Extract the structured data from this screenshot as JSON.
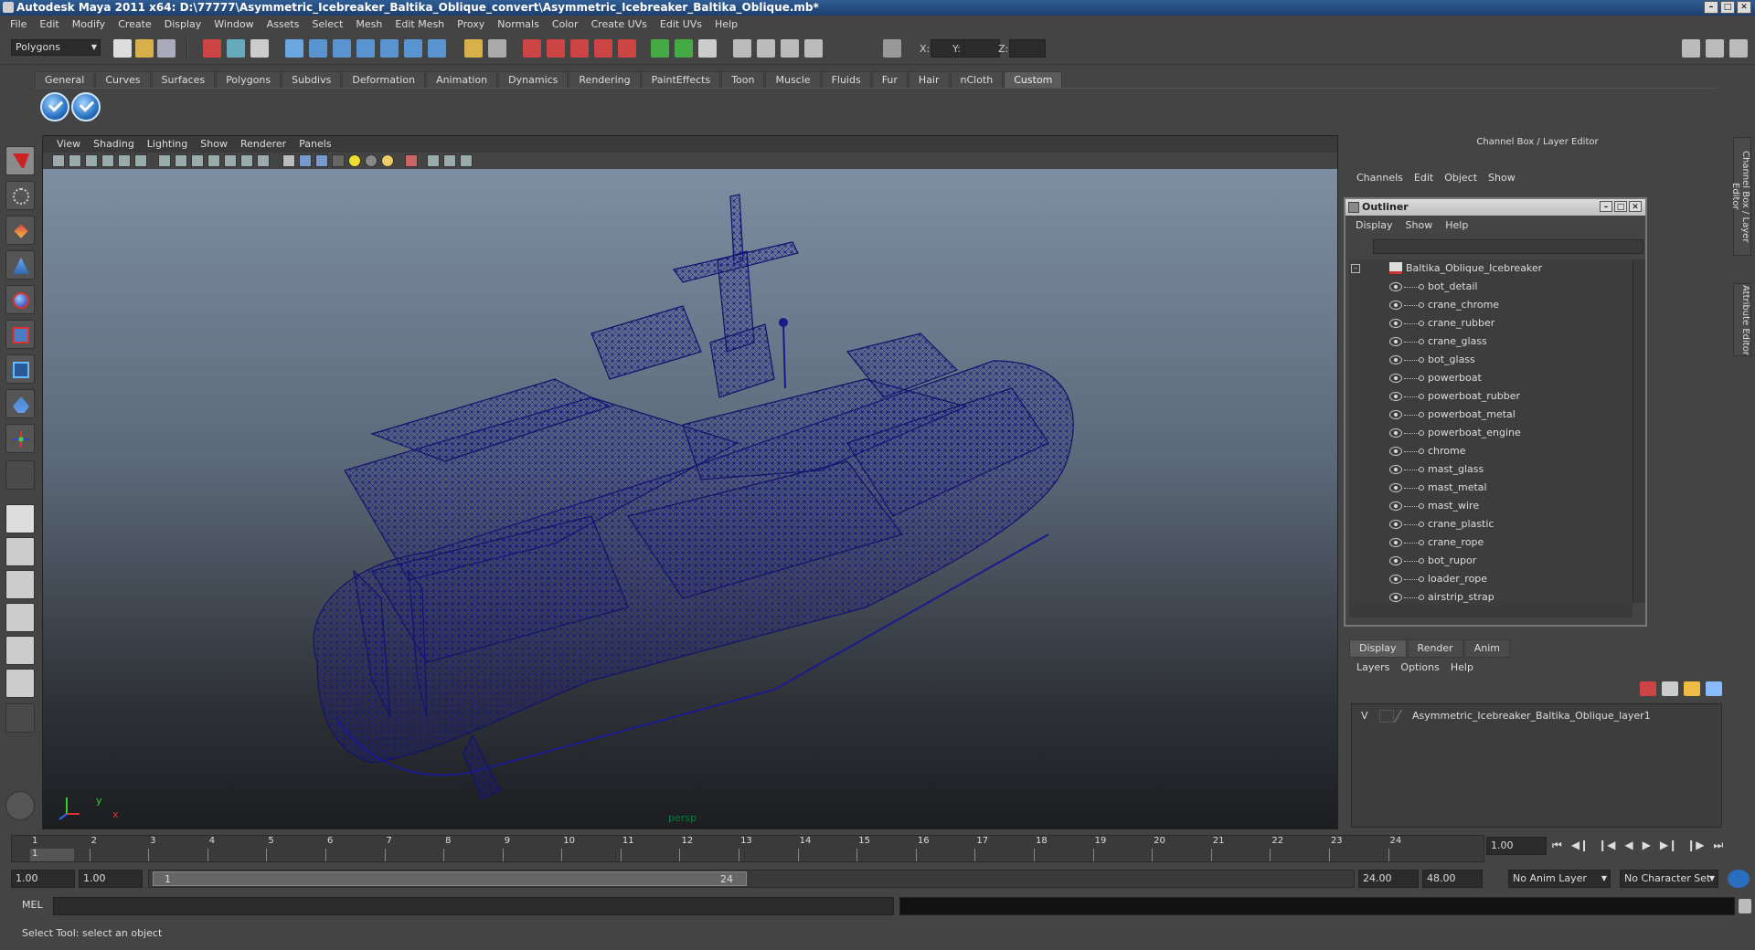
{
  "window": {
    "title": "Autodesk Maya 2011 x64: D:\\77777\\Asymmetric_Icebreaker_Baltika_Oblique_convert\\Asymmetric_Icebreaker_Baltika_Oblique.mb*"
  },
  "menubar": [
    "File",
    "Edit",
    "Modify",
    "Create",
    "Display",
    "Window",
    "Assets",
    "Select",
    "Mesh",
    "Edit Mesh",
    "Proxy",
    "Normals",
    "Color",
    "Create UVs",
    "Edit UVs",
    "Help"
  ],
  "status": {
    "mode": "Polygons",
    "x_label": "X:",
    "y_label": "Y:",
    "z_label": "Z:"
  },
  "shelf": {
    "tabs": [
      "General",
      "Curves",
      "Surfaces",
      "Polygons",
      "Subdivs",
      "Deformation",
      "Animation",
      "Dynamics",
      "Rendering",
      "PaintEffects",
      "Toon",
      "Muscle",
      "Fluids",
      "Fur",
      "Hair",
      "nCloth",
      "Custom"
    ],
    "active": "Custom"
  },
  "viewport": {
    "menu": [
      "View",
      "Shading",
      "Lighting",
      "Show",
      "Renderer",
      "Panels"
    ],
    "camera": "persp",
    "axis_x": "x",
    "axis_y": "y"
  },
  "channelbox": {
    "title": "Channel Box / Layer Editor",
    "menu": [
      "Channels",
      "Edit",
      "Object",
      "Show"
    ]
  },
  "outliner": {
    "title": "Outliner",
    "menu": [
      "Display",
      "Show",
      "Help"
    ],
    "root": "Baltika_Oblique_Icebreaker",
    "items": [
      "bot_detail",
      "crane_chrome",
      "crane_rubber",
      "crane_glass",
      "bot_glass",
      "powerboat",
      "powerboat_rubber",
      "powerboat_metal",
      "powerboat_engine",
      "chrome",
      "mast_glass",
      "mast_metal",
      "mast_wire",
      "crane_plastic",
      "crane_rope",
      "bot_rupor",
      "loader_rope",
      "airstrip_strap"
    ]
  },
  "layer_editor": {
    "tabs": [
      "Display",
      "Render",
      "Anim"
    ],
    "active": "Display",
    "menu": [
      "Layers",
      "Options",
      "Help"
    ],
    "layer_visibility": "V",
    "layer_name": "Asymmetric_Icebreaker_Baltika_Oblique_layer1"
  },
  "side_tabs": [
    "Channel Box / Layer Editor",
    "Attribute Editor"
  ],
  "timeline": {
    "ticks": [
      "1",
      "2",
      "3",
      "4",
      "5",
      "6",
      "7",
      "8",
      "9",
      "10",
      "11",
      "12",
      "13",
      "14",
      "15",
      "16",
      "17",
      "18",
      "19",
      "20",
      "21",
      "22",
      "23",
      "24"
    ],
    "current_frame_marker": "1",
    "current_time": "1.00"
  },
  "range": {
    "start": "1.00",
    "playback_start": "1.00",
    "slider_start": "1",
    "slider_end": "24",
    "playback_end": "24.00",
    "end": "48.00",
    "anim_layer": "No Anim Layer",
    "character_set": "No Character Set"
  },
  "command_line": {
    "label": "MEL"
  },
  "help_line": "Select Tool: select an object"
}
